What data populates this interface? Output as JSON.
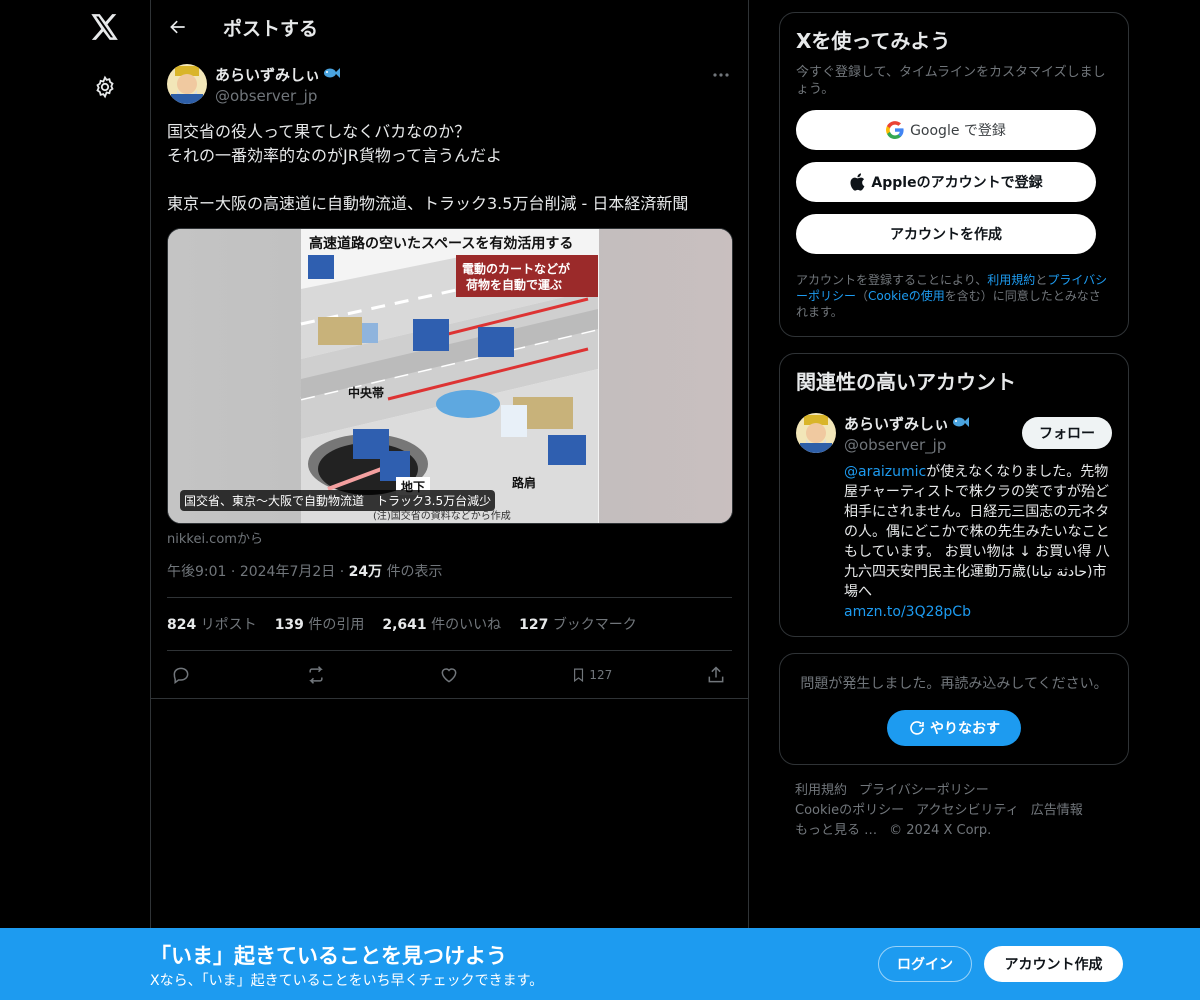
{
  "header": {
    "title": "ポストする"
  },
  "post": {
    "author_name": "あらいずみしぃ",
    "author_handle": "@observer_jp",
    "text": "国交省の役人って果てしなくバカなのか？\nそれの一番効率的なのがJR貨物って言うんだよ\n\n東京ー大阪の高速道に自動物流道、トラック3.5万台削減 - 日本経済新聞",
    "media": {
      "headline": "高速道路の空いたスペースを有効活用する",
      "callout_line1": "電動のカートなどが",
      "callout_line2": "荷物を自動で運ぶ",
      "label_median": "中央帯",
      "label_underground": "地下",
      "label_shoulder": "路肩",
      "note": "(注)国交省の資料などから作成",
      "caption": "国交省、東京〜大阪で自動物流道　トラック3.5万台減少"
    },
    "source": "nikkei.comから",
    "time": "午後9:01",
    "date": "2024年7月2日",
    "views_count": "24万",
    "views_label": "件の表示",
    "stats": {
      "reposts_count": "824",
      "reposts_label": "リポスト",
      "quotes_count": "139",
      "quotes_label": "件の引用",
      "likes_count": "2,641",
      "likes_label": "件のいいね",
      "bookmarks_count": "127",
      "bookmarks_label": "ブックマーク"
    },
    "bookmark_action_count": "127"
  },
  "signup_card": {
    "title": "Xを使ってみよう",
    "subtitle": "今すぐ登録して、タイムラインをカスタマイズしましょう。",
    "google_label": "Google で登録",
    "apple_label": "Appleのアカウントで登録",
    "create_label": "アカウントを作成",
    "legal_1": "アカウントを登録することにより、",
    "legal_terms": "利用規約",
    "legal_2": "と",
    "legal_privacy": "プライバシーポリシー",
    "legal_3": "（",
    "legal_cookie": "Cookieの使用",
    "legal_4": "を含む）に同意したとみなされます。"
  },
  "related": {
    "title": "関連性の高いアカウント",
    "name": "あらいずみしぃ",
    "handle": "@observer_jp",
    "follow_label": "フォロー",
    "bio_mention": "@araizumic",
    "bio_text": "が使えなくなりました。先物屋チャーティストで株クラの笑ですが殆ど相手にされません。日経元三国志の元ネタの人。偶にどこかで株の先生みたいなこともしています。 お買い物は ↓ お買い得 八九六四天安門民主化運動万歳(حادثة تيانا)市場へ",
    "bio_link": "amzn.to/3Q28pCb"
  },
  "error_card": {
    "message": "問題が発生しました。再読み込みしてください。",
    "retry_label": "やりなおす"
  },
  "footer": {
    "terms": "利用規約",
    "privacy": "プライバシーポリシー",
    "cookie": "Cookieのポリシー",
    "accessibility": "アクセシビリティ",
    "ads": "広告情報",
    "more": "もっと見る …",
    "copyright": "© 2024 X Corp."
  },
  "banner": {
    "title": "「いま」起きていることを見つけよう",
    "subtitle": "Xなら、「いま」起きていることをいち早くチェックできます。",
    "login_label": "ログイン",
    "signup_label": "アカウント作成"
  },
  "colors": {
    "accent": "#1d9bf0",
    "background": "#000000",
    "border": "#2f3336",
    "muted": "#71767b"
  }
}
